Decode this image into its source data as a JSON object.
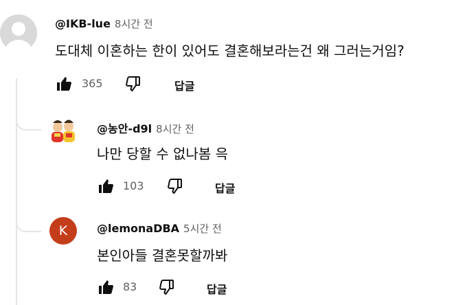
{
  "comments": [
    {
      "author": "@IKB-lue",
      "time": "8시간 전",
      "text": "도대체 이혼하는 한이 있어도 결혼해보라는건 왜 그러는거임?",
      "likes": "365",
      "reply_label": "답글",
      "avatar_icon": "default-person-icon"
    },
    {
      "author": "@농안-d9l",
      "time": "8시간 전",
      "text": "나만 당할 수 없나봄 윽",
      "likes": "103",
      "reply_label": "답글",
      "avatar_icon": "character-pair-avatar"
    },
    {
      "author": "@lemonaDBA",
      "time": "5시간 전",
      "text": "본인아들 결혼못할까봐",
      "likes": "83",
      "reply_label": "답글",
      "avatar_letter": "K",
      "avatar_color": "#c43d1b"
    }
  ],
  "colors": {
    "text": "#0f0f0f",
    "secondary": "#606060",
    "thread": "#e5e5e5"
  }
}
